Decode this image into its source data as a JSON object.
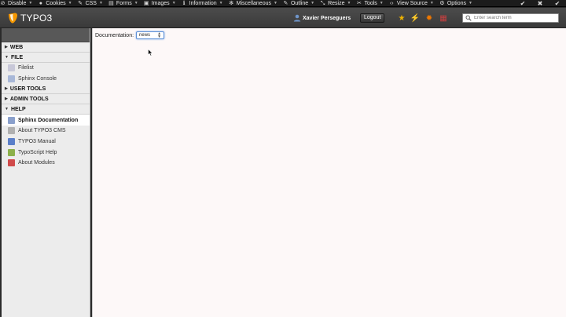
{
  "devbar": {
    "items": [
      {
        "icon": "disable-icon",
        "glyph": "⊘",
        "label": "Disable"
      },
      {
        "icon": "cookies-icon",
        "glyph": "●",
        "label": "Cookies"
      },
      {
        "icon": "css-icon",
        "glyph": "✎",
        "label": "CSS"
      },
      {
        "icon": "forms-icon",
        "glyph": "▤",
        "label": "Forms"
      },
      {
        "icon": "images-icon",
        "glyph": "▣",
        "label": "Images"
      },
      {
        "icon": "information-icon",
        "glyph": "ℹ",
        "label": "Information"
      },
      {
        "icon": "miscellaneous-icon",
        "glyph": "✻",
        "label": "Miscellaneous"
      },
      {
        "icon": "outline-icon",
        "glyph": "✎",
        "label": "Outline"
      },
      {
        "icon": "resize-icon",
        "glyph": "⤡",
        "label": "Resize"
      },
      {
        "icon": "tools-icon",
        "glyph": "✂",
        "label": "Tools"
      },
      {
        "icon": "view-source-icon",
        "glyph": "‹›",
        "label": "View Source"
      },
      {
        "icon": "options-icon",
        "glyph": "⚙",
        "label": "Options"
      }
    ],
    "right": [
      "✔",
      "✖",
      "✔"
    ]
  },
  "topbar": {
    "logo_text": "TYPO3",
    "user_name": "Xavier Perseguers",
    "logout_label": "Logout",
    "search_placeholder": "Enter search term",
    "icons": [
      {
        "name": "bookmarks-icon",
        "glyph": "★",
        "color": "#f0b400"
      },
      {
        "name": "clear-cache-icon",
        "glyph": "⚡",
        "color": "#f0a000"
      },
      {
        "name": "workspace-icon",
        "glyph": "✹",
        "color": "#f07800"
      },
      {
        "name": "live-search-icon",
        "glyph": "▦",
        "color": "#c94040"
      }
    ],
    "brand_color": "#f49700"
  },
  "sidebar": {
    "groups": [
      {
        "label": "WEB",
        "expanded": false,
        "modules": []
      },
      {
        "label": "FILE",
        "expanded": true,
        "modules": [
          {
            "label": "Filelist",
            "icon": "filelist-icon",
            "color": "#c8c8d8",
            "active": false
          },
          {
            "label": "Sphinx Console",
            "icon": "sphinx-console-icon",
            "color": "#a8b8d8",
            "active": false
          }
        ]
      },
      {
        "label": "USER TOOLS",
        "expanded": false,
        "modules": []
      },
      {
        "label": "ADMIN TOOLS",
        "expanded": false,
        "modules": []
      },
      {
        "label": "HELP",
        "expanded": true,
        "modules": [
          {
            "label": "Sphinx Documentation",
            "icon": "sphinx-documentation-icon",
            "color": "#8aa0cc",
            "active": true
          },
          {
            "label": "About TYPO3 CMS",
            "icon": "about-typo3-icon",
            "color": "#b0b0b0",
            "active": false
          },
          {
            "label": "TYPO3 Manual",
            "icon": "typo3-manual-icon",
            "color": "#5b7fc9",
            "active": false
          },
          {
            "label": "TypoScript Help",
            "icon": "typoscript-help-icon",
            "color": "#8cb04a",
            "active": false
          },
          {
            "label": "About Modules",
            "icon": "about-modules-icon",
            "color": "#d04a4a",
            "active": false
          }
        ]
      }
    ]
  },
  "content": {
    "doc_label": "Documentation:",
    "doc_value": "news"
  }
}
